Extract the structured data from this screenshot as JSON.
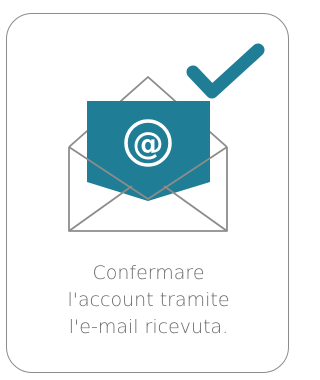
{
  "card": {
    "caption_lines": [
      "Confermare",
      "l'account tramite",
      "l'e-mail ricevuta."
    ],
    "at_symbol": "@"
  },
  "colors": {
    "accent": "#1f7d95",
    "outline": "#8c8c8c",
    "text": "#6b6b6b"
  },
  "icons": [
    "envelope-open-icon",
    "at-sign-icon",
    "checkmark-icon"
  ]
}
